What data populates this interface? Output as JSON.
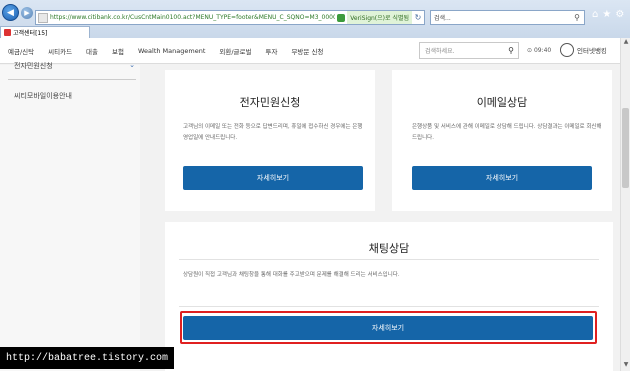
{
  "browser": {
    "url": "https://www.citibank.co.kr/CusCntMain0100.act?MENU_TYPE=footer&MENU_C_SQNO=M3_000070",
    "verisign_label": "VeriSign(으)로 식별됨",
    "search_placeholder": "검색...",
    "tab_title": "고객센터[15]"
  },
  "header": {
    "menu": [
      "예금/신탁",
      "씨티카드",
      "대출",
      "보험",
      "Wealth Management",
      "외환/글로벌",
      "투자",
      "무방문 신청"
    ],
    "search_placeholder": "검색하세요.",
    "clock": "09:40",
    "user_label": "인터넷뱅킹"
  },
  "sidebar": {
    "items": [
      "전자민원신청",
      "씨티모바일이용안내"
    ]
  },
  "cards": {
    "complaint": {
      "title": "전자민원신청",
      "description": "고객님의 이메일 또는 전화 등으로 답변드리며, 휴일에 접수하신 경우에는 은행 영업일에 안내드립니다.",
      "button": "자세히보기"
    },
    "email": {
      "title": "이메일상담",
      "description": "은행상품 및 서비스에 관해 이메일로 상담해 드립니다. 상담결과는 이메일로 회신해 드립니다.",
      "button": "자세히보기"
    },
    "chat": {
      "title": "채팅상담",
      "description": "상담원이 직접 고객님과 채팅창을 통해 대화를 주고받으며 문제를 해결해 드리는 서비스입니다.",
      "button": "자세히보기"
    }
  },
  "watermark": "http://babatree.tistory.com",
  "colors": {
    "accent_button": "#1565a8",
    "highlight_border": "#e02020"
  }
}
